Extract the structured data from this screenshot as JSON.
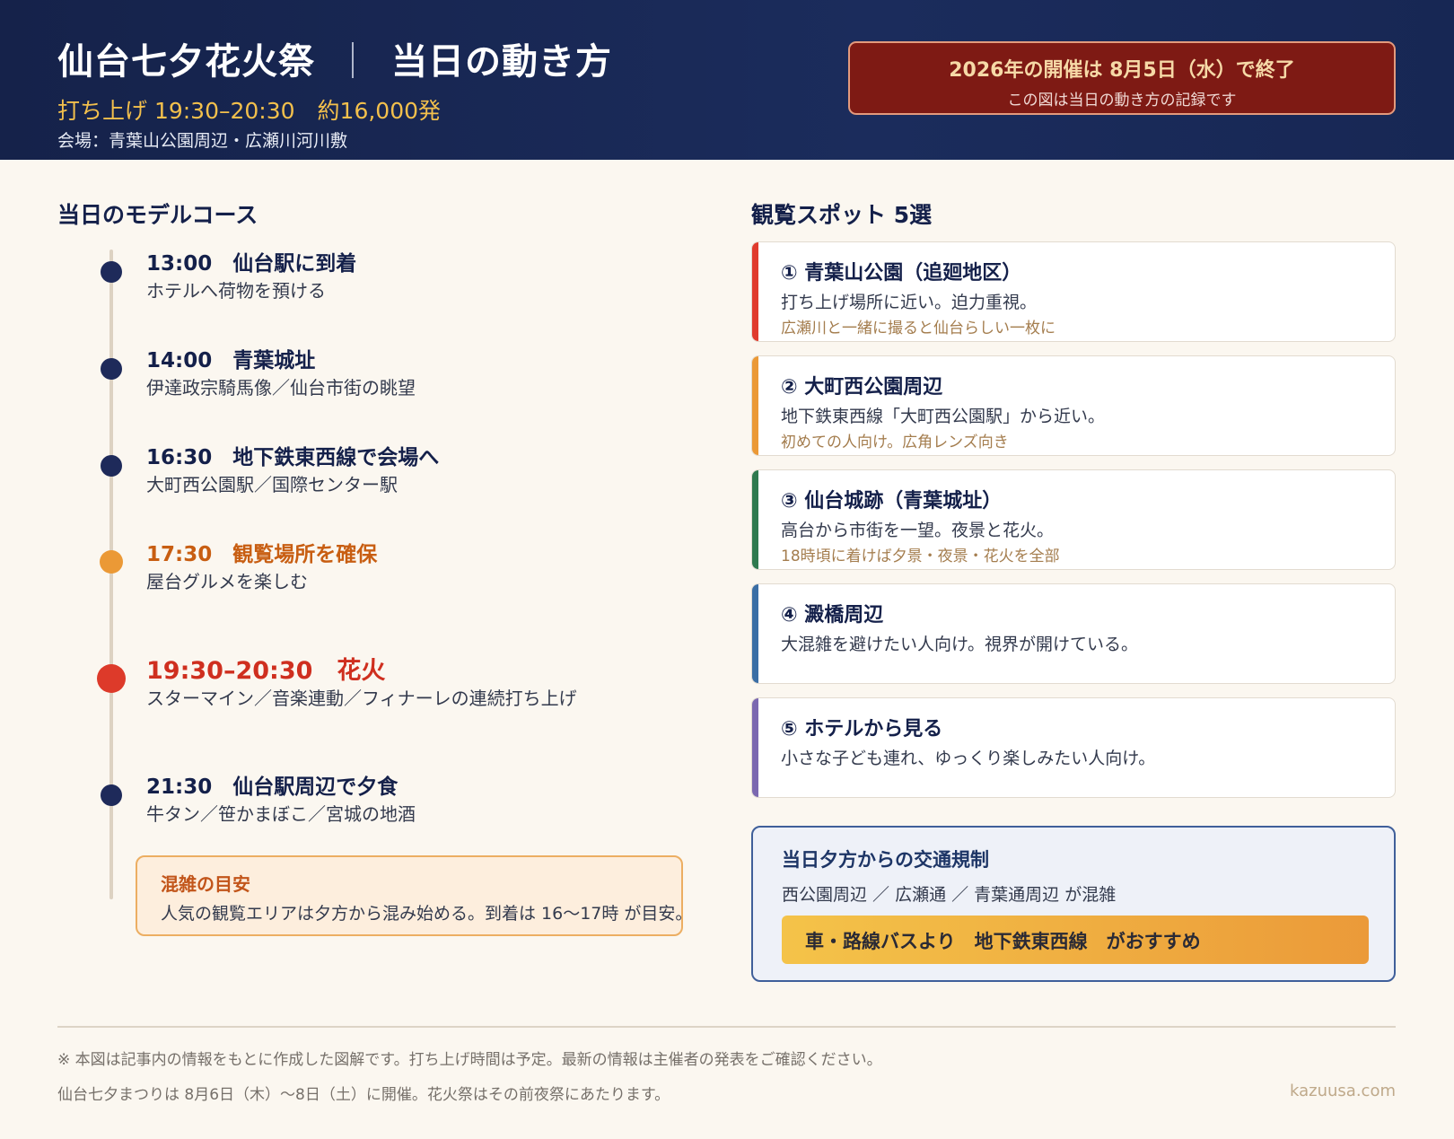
{
  "header": {
    "title": "仙台七夕花火祭",
    "title_separator": "｜",
    "title_sub": "当日の動き方",
    "subtitle": "打ち上げ 19:30–20:30　約16,000発",
    "venue": "会場：青葉山公園周辺・広瀬川河川敷",
    "notice": {
      "main": "2026年の開催は 8月5日（水）で終了",
      "sub": "この図は当日の動き方の記録です"
    }
  },
  "model_course": {
    "title": "当日のモデルコース",
    "items": [
      {
        "time": "13:00　仙台駅に到着",
        "desc": "ホテルへ荷物を預ける"
      },
      {
        "time": "14:00　青葉城址",
        "desc": "伊達政宗騎馬像／仙台市街の眺望"
      },
      {
        "time": "16:30　地下鉄東西線で会場へ",
        "desc": "大町西公園駅／国際センター駅"
      },
      {
        "time": "17:30　観覧場所を確保",
        "desc": "屋台グルメを楽しむ"
      },
      {
        "time": "19:30–20:30　花火",
        "desc": "スターマイン／音楽連動／フィナーレの連続打ち上げ"
      },
      {
        "time": "21:30　仙台駅周辺で夕食",
        "desc": "牛タン／笹かまぼこ／宮城の地酒"
      }
    ],
    "crowd": {
      "title": "混雑の目安",
      "body": "人気の観覧エリアは夕方から混み始める。到着は 16〜17時 が目安。"
    }
  },
  "spots": {
    "title": "観覧スポット 5選",
    "items": [
      {
        "name": "① 青葉山公園（追廻地区）",
        "desc": "打ち上げ場所に近い。迫力重視。",
        "tip": "広瀬川と一緒に撮ると仙台らしい一枚に",
        "color": "#e03b2d"
      },
      {
        "name": "② 大町西公園周辺",
        "desc": "地下鉄東西線「大町西公園駅」から近い。",
        "tip": "初めての人向け。広角レンズ向き",
        "color": "#eb9936"
      },
      {
        "name": "③ 仙台城跡（青葉城址）",
        "desc": "高台から市街を一望。夜景と花火。",
        "tip": "18時頃に着けば夕景・夜景・花火を全部",
        "color": "#2f7a4f"
      },
      {
        "name": "④ 澱橋周辺",
        "desc": "大混雑を避けたい人向け。視界が開けている。",
        "tip": "",
        "color": "#3a6ea5"
      },
      {
        "name": "⑤ ホテルから見る",
        "desc": "小さな子ども連れ、ゆっくり楽しみたい人向け。",
        "tip": "",
        "color": "#7b68b0"
      }
    ]
  },
  "traffic": {
    "title": "当日夕方からの交通規制",
    "areas": "西公園周辺 ／ 広瀬通 ／ 青葉通周辺 が混雑",
    "recommendation": "車・路線バスより　地下鉄東西線　がおすすめ"
  },
  "footer": {
    "note1": "※ 本図は記事内の情報をもとに作成した図解です。打ち上げ時間は予定。最新の情報は主催者の発表をご確認ください。",
    "note2": "仙台七夕まつりは 8月6日（木）〜8日（土）に開催。花火祭はその前夜祭にあたります。",
    "brand": "kazuusa.com"
  }
}
